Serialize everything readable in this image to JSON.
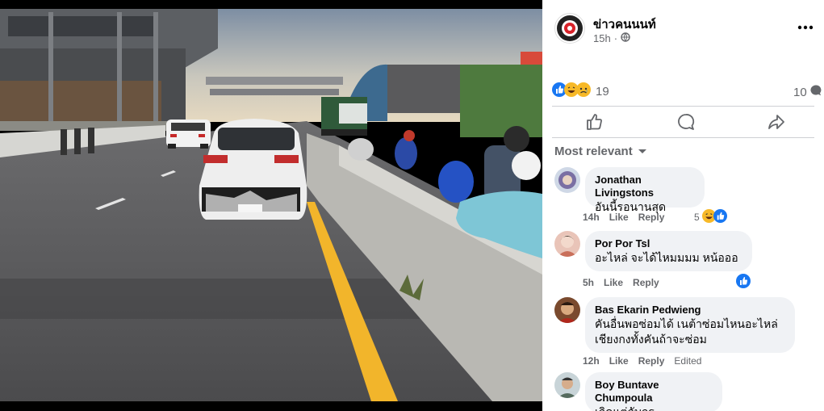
{
  "post": {
    "page_name": "ข่าวคนนนท์",
    "time": "15h",
    "separator": "·",
    "reaction_count": "19",
    "comment_count": "10"
  },
  "filter": {
    "label": "Most relevant"
  },
  "comments": [
    {
      "author": "Jonathan Livingstons",
      "lines": [
        "อันนี้รอนานสุด"
      ],
      "time": "14h",
      "like": "Like",
      "reply": "Reply",
      "reactions": "5"
    },
    {
      "author": "Por Por Tsl",
      "lines": [
        "อะไหล่ จะได้ไหมมมม หน้อออ"
      ],
      "time": "5h",
      "like": "Like",
      "reply": "Reply"
    },
    {
      "author": "Bas Ekarin Pedwieng",
      "lines": [
        "คันอื่นพอซ่อมได้ เนต้าซ่อมไหนอะไหล่",
        "เชียงกงทั้งคันถ้าจะซ่อม"
      ],
      "time": "12h",
      "like": "Like",
      "reply": "Reply",
      "edited": "Edited"
    },
    {
      "author": "Boy Buntave Chumpoula",
      "lines": [
        "เกิดแต่กับกรู"
      ]
    }
  ],
  "icons": {
    "privacy": "globe-icon",
    "more": "more-options-icon",
    "like": "like-thumb-icon",
    "comment": "comment-bubble-icon",
    "share": "share-arrow-icon",
    "sort": "chevron-down-icon"
  },
  "colors": {
    "like_blue": "#1877f2",
    "haha_yellow": "#f7b928",
    "text_secondary": "#65676b",
    "bubble": "#f0f2f5",
    "lane_yellow": "#f2b52b"
  }
}
